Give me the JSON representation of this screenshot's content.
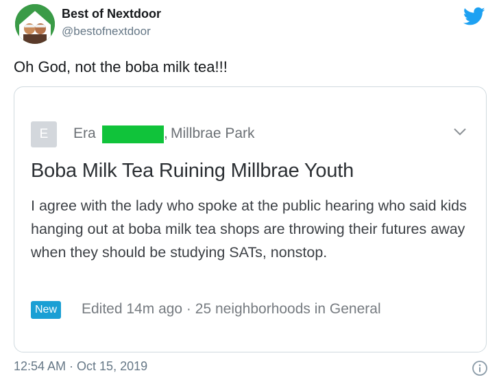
{
  "tweet": {
    "display_name": "Best of Nextdoor",
    "handle": "@bestofnextdoor",
    "text": "Oh God, not the boba milk tea!!!",
    "timestamp": "12:54 AM · Oct 15, 2019",
    "brand_color": "#1da1f2"
  },
  "post": {
    "avatar_letter": "E",
    "author_name": "Era",
    "separator": ",",
    "neighborhood": "Millbrae Park",
    "title": "Boba Milk Tea Ruining Millbrae Youth",
    "body": "I agree with the lady who spoke at the public hearing who said kids hanging out at boba milk tea shops are throwing their futures away when they should be studying SATs, nonstop.",
    "badge": "New",
    "meta": "Edited 14m ago · 25 neighborhoods in General",
    "redaction_color": "#10c33a"
  },
  "icons": [
    "twitter-bird-icon",
    "chevron-down-icon",
    "info-icon"
  ]
}
